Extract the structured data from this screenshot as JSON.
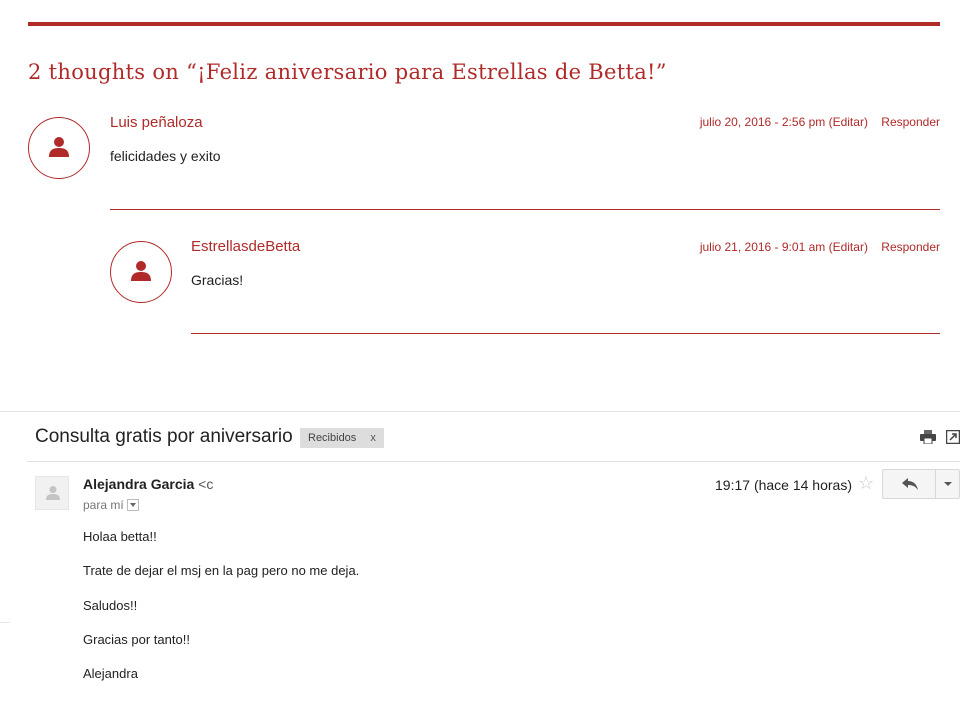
{
  "comments_section": {
    "title": "2 thoughts on “¡Feliz aniversario para Estrellas de Betta!”",
    "comments": [
      {
        "author": "Luis peñaloza",
        "date": "julio 20, 2016 - 2:56 pm",
        "edit": "(Editar)",
        "reply": "Responder",
        "text": "felicidades y exito"
      },
      {
        "author": "EstrellasdeBetta",
        "date": "julio 21, 2016 - 9:01 am",
        "edit": "(Editar)",
        "reply": "Responder",
        "text": "Gracias!"
      }
    ]
  },
  "email": {
    "subject": "Consulta gratis por aniversario",
    "label": "Recibidos",
    "label_remove": "x",
    "sender_name": "Alejandra Garcia",
    "sender_addr": "<c",
    "to": "para mí",
    "time": "19:17 (hace 14 horas)",
    "star": "☆",
    "body": [
      "Holaa betta!!",
      "Trate de dejar el msj en la pag pero no me deja.",
      "Saludos!!",
      "Gracias por tanto!!",
      "Alejandra"
    ]
  },
  "icons": {
    "avatar": "person-icon",
    "print": "print-icon",
    "new_window": "new-window-icon",
    "reply": "reply-icon",
    "more": "dropdown-arrow-icon"
  },
  "colors": {
    "accent": "#b02a2a",
    "text": "#222222",
    "label_bg": "#dddddd"
  }
}
